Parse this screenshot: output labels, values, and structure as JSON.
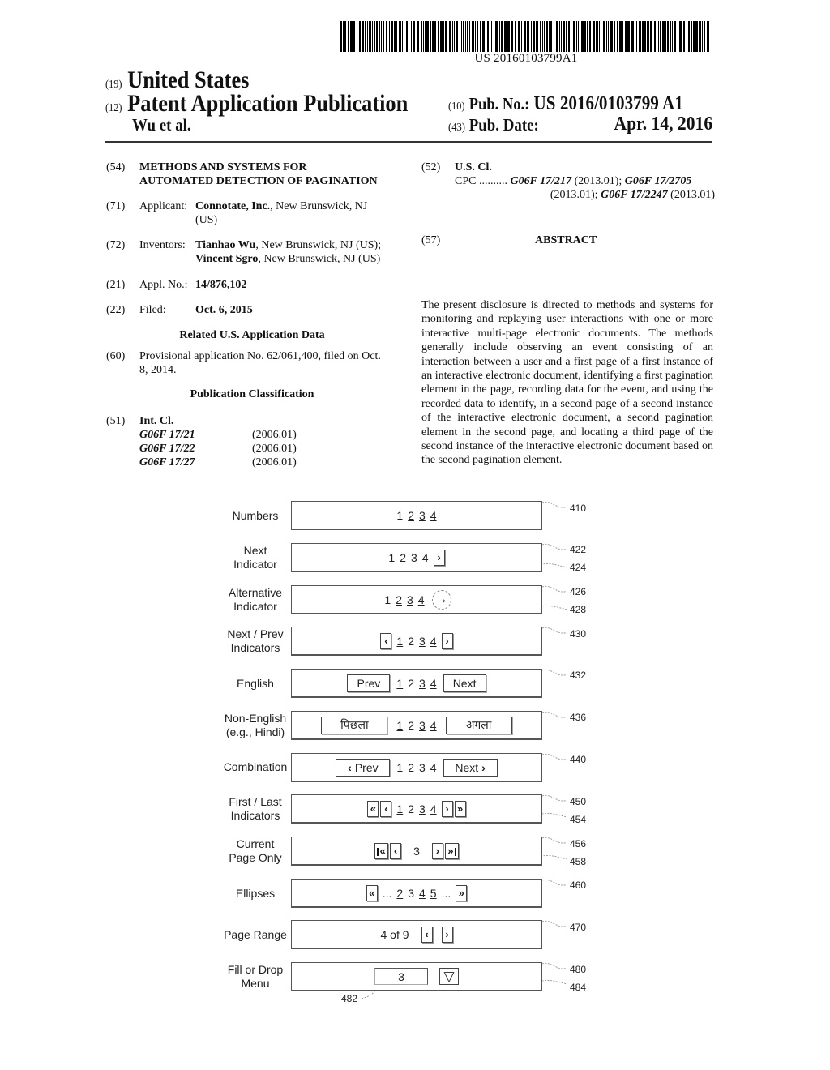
{
  "header": {
    "barcode_text": "US 20160103799A1",
    "country_code": "(19)",
    "country": "United States",
    "pubtype_code": "(12)",
    "pubtype": "Patent Application Publication",
    "authors": "Wu et al.",
    "pubno_code": "(10)",
    "pubno_label": "Pub. No.:",
    "pubno": "US 2016/0103799 A1",
    "pubdate_code": "(43)",
    "pubdate_label": "Pub. Date:",
    "pubdate": "Apr. 14, 2016"
  },
  "biblio": {
    "title": {
      "code": "(54)",
      "line1": "METHODS AND SYSTEMS FOR",
      "line2": "AUTOMATED DETECTION OF PAGINATION"
    },
    "applicant": {
      "code": "(71)",
      "label": "Applicant:",
      "name": "Connotate, Inc.",
      "loc1": ", New Brunswick, NJ",
      "loc2": "(US)"
    },
    "inventors": {
      "code": "(72)",
      "label": "Inventors:",
      "name1": "Tianhao Wu",
      "loc1": ", New Brunswick, NJ (US);",
      "name2": "Vincent Sgro",
      "loc2": ", New Brunswick, NJ (US)"
    },
    "appl_no": {
      "code": "(21)",
      "label": "Appl. No.:",
      "value": "14/876,102"
    },
    "filed": {
      "code": "(22)",
      "label": "Filed:",
      "value": "Oct. 6, 2015"
    },
    "related_heading": "Related U.S. Application Data",
    "provisional": {
      "code": "(60)",
      "line1": "Provisional application No. 62/061,400, filed on Oct.",
      "line2": "8, 2014."
    },
    "classification_heading": "Publication Classification",
    "int_cl": {
      "code": "(51)",
      "label": "Int. Cl.",
      "items": [
        {
          "class": "G06F 17/21",
          "version": "(2006.01)"
        },
        {
          "class": "G06F 17/22",
          "version": "(2006.01)"
        },
        {
          "class": "G06F 17/27",
          "version": "(2006.01)"
        }
      ]
    },
    "us_cl": {
      "code": "(52)",
      "label": "U.S. Cl.",
      "cpc_label": "CPC ..........",
      "c1": "G06F 17/217",
      "v1": " (2013.01); ",
      "c2": "G06F 17/2705",
      "v2": "(2013.01); ",
      "c3": "G06F 17/2247",
      "v3": " (2013.01)"
    },
    "abstract": {
      "code": "(57)",
      "heading": "ABSTRACT",
      "text": "The present disclosure is directed to methods and systems for monitoring and replaying user interactions with one or more interactive multi-page electronic documents. The methods generally include observing an event consisting of an interaction between a user and a first page of a first instance of an interactive electronic document, identifying a first pagination element in the page, recording data for the event, and using the recorded data to identify, in a second page of a second instance of the interactive electronic document, a second pagination element in the second page, and locating a third page of the second instance of the interactive electronic document based on the second pagination element."
    }
  },
  "figure": {
    "rows": [
      {
        "label1": "Numbers",
        "label2": "",
        "ref": "410"
      },
      {
        "label1": "Next",
        "label2": "Indicator",
        "ref": "422",
        "ref2": "424"
      },
      {
        "label1": "Alternative",
        "label2": "Indicator",
        "ref": "426",
        "ref2": "428"
      },
      {
        "label1": "Next / Prev",
        "label2": "Indicators",
        "ref": "430"
      },
      {
        "label1": "English",
        "label2": "",
        "ref": "432"
      },
      {
        "label1": "Non-English",
        "label2": "(e.g., Hindi)",
        "ref": "436"
      },
      {
        "label1": "Combination",
        "label2": "",
        "ref": "440"
      },
      {
        "label1": "First / Last",
        "label2": "Indicators",
        "ref": "450",
        "ref2": "454"
      },
      {
        "label1": "Current",
        "label2": "Page Only",
        "ref": "456",
        "ref2": "458"
      },
      {
        "label1": "Ellipses",
        "label2": "",
        "ref": "460"
      },
      {
        "label1": "Page Range",
        "label2": "",
        "ref": "470"
      },
      {
        "label1": "Fill or Drop",
        "label2": "Menu",
        "ref": "480",
        "ref2": "484",
        "ref3": "482"
      }
    ],
    "pages": [
      "1",
      "2",
      "3",
      "4"
    ],
    "ellipsis_pages": [
      "2",
      "3",
      "4",
      "5"
    ],
    "ellipsis": "...",
    "current_page": "3",
    "range_text": "4 of 9",
    "fill_value": "3",
    "prev_en": "Prev",
    "next_en": "Next",
    "prev_hi": "पिछला",
    "next_hi": "अगला",
    "icons": {
      "prev": "‹",
      "next": "›",
      "first": "«",
      "last": "»",
      "arrow": "→",
      "dropdown": "▽"
    }
  }
}
